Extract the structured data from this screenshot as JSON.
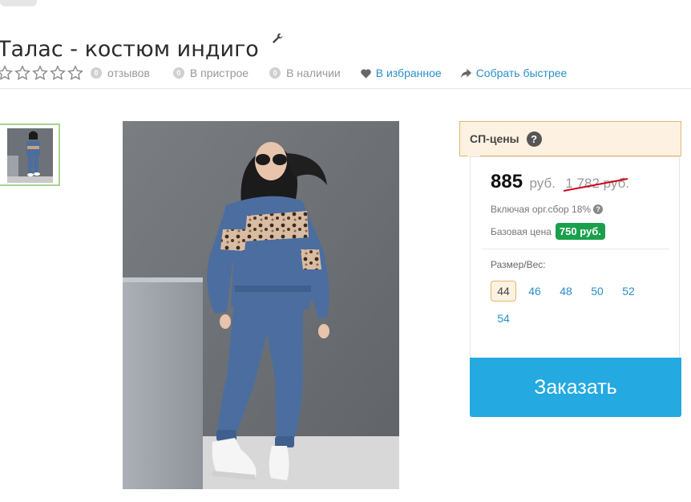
{
  "product": {
    "title": "Талас - костюм индиго"
  },
  "meta": {
    "reviews_count": "0",
    "reviews_label": "отзывов",
    "prebuild_count": "0",
    "prebuild_label": "В пристрое",
    "stock_count": "0",
    "stock_label": "В наличии",
    "favorite_label": "В избранное",
    "collect_label": "Собрать быстрее",
    "rating": 0,
    "rating_max": 5
  },
  "price": {
    "header": "СП-цены",
    "help_glyph": "?",
    "current": "885",
    "currency": "руб.",
    "old": "1 782 руб.",
    "fee_text": "Включая орг.сбор 18%",
    "base_label": "Базовая цена",
    "base_value": "750 руб."
  },
  "sizes": {
    "label": "Размер/Вес:",
    "options": [
      "44",
      "46",
      "48",
      "50",
      "52",
      "54"
    ],
    "selected": "44"
  },
  "order_button": "Заказать",
  "colors": {
    "link": "#2a8fc9",
    "order_button": "#24a9e0",
    "base_badge": "#1aa04c",
    "sp_header_bg": "#fdf2e1",
    "sp_header_border": "#e3b66a"
  }
}
